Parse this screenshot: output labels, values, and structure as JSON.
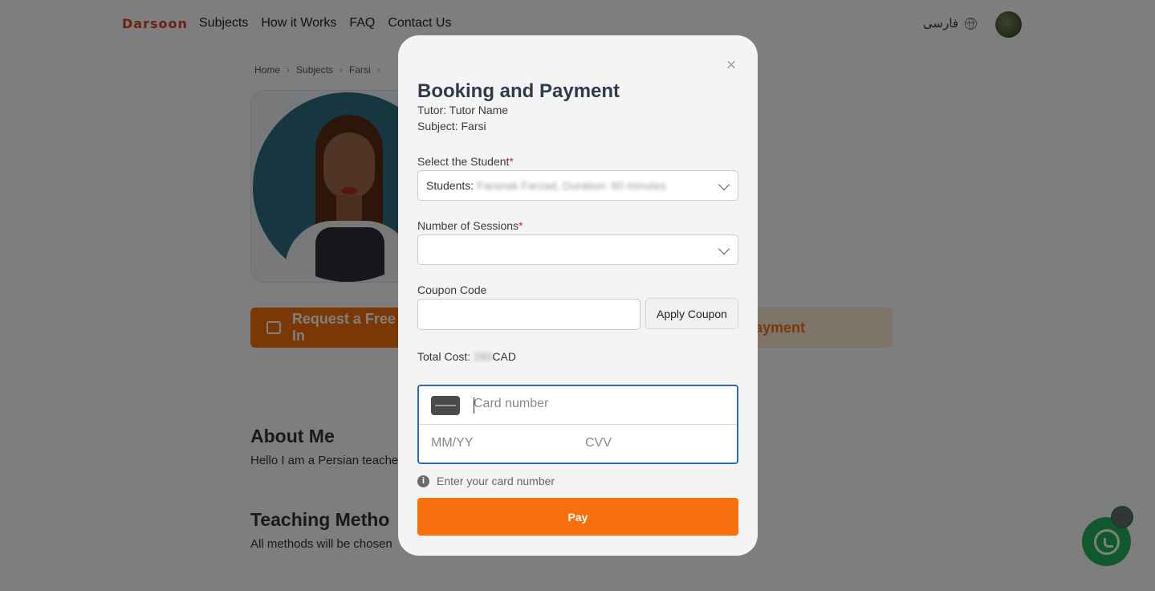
{
  "nav": {
    "logo": "Darsoon",
    "links": [
      "Subjects",
      "How it Works",
      "FAQ",
      "Contact Us"
    ],
    "language": "فارسی"
  },
  "breadcrumb": [
    "Home",
    "Subjects",
    "Farsi"
  ],
  "profile": {
    "cta_left": "Request a Free In",
    "cta_right": "ayment",
    "about_heading": "About Me",
    "about_text": "Hello I am a Persian teache",
    "teaching_heading": "Teaching Metho",
    "teaching_text": "All methods will be chosen"
  },
  "modal": {
    "title": "Booking and Payment",
    "tutor_line": "Tutor: Tutor Name",
    "subject_line": "Subject: Farsi",
    "student_label": "Select the Student",
    "student_required": "*",
    "student_prefix": "Students:",
    "student_value": "Faranak Farzad, Duration: 60 minutes",
    "sessions_label": "Number of Sessions",
    "sessions_required": "*",
    "sessions_value": "",
    "coupon_label": "Coupon Code",
    "coupon_value": "",
    "apply_coupon": "Apply Coupon",
    "total_label": "Total Cost:",
    "total_amount": "280",
    "currency": "CAD",
    "card_number_placeholder": "Card number",
    "expiry_placeholder": "MM/YY",
    "cvv_placeholder": "CVV",
    "hint": "Enter your card number",
    "pay": "Pay",
    "close": "×"
  },
  "colors": {
    "accent": "#f7700d",
    "accent_light": "#fde6d2",
    "focus_border": "#2f6cb6",
    "whatsapp": "#25b15a",
    "required": "#e0262b"
  },
  "icons": [
    "globe-icon",
    "chevron-right-icon",
    "chevron-down-icon",
    "close-icon",
    "credit-card-icon",
    "info-icon",
    "whatsapp-icon"
  ]
}
